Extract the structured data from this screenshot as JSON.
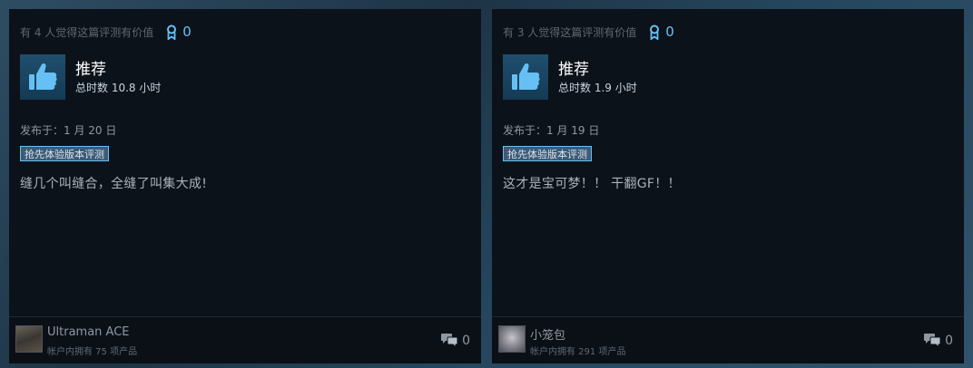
{
  "reviews": [
    {
      "helpful_text": "有 4 人觉得这篇评测有价值",
      "award_count": "0",
      "recommendation": "推荐",
      "hours": "总时数 10.8 小时",
      "posted": "发布于：1 月 20 日",
      "early_access_label": "抢先体验版本评测",
      "text": "缝几个叫缝合，全缝了叫集大成!",
      "author": "Ultraman ACE",
      "products": "帐户内拥有 75 项产品",
      "comment_count": "0"
    },
    {
      "helpful_text": "有 3 人觉得这篇评测有价值",
      "award_count": "0",
      "recommendation": "推荐",
      "hours": "总时数 1.9 小时",
      "posted": "发布于：1 月 19 日",
      "early_access_label": "抢先体验版本评测",
      "text": "这才是宝可梦！！ 干翻GF！！",
      "author": "小笼包",
      "products": "帐户内拥有 291 项产品",
      "comment_count": "0"
    }
  ],
  "colors": {
    "accent": "#66c0f4",
    "card_bg": "#0c121a",
    "badge_bg": "#3e5a76"
  }
}
